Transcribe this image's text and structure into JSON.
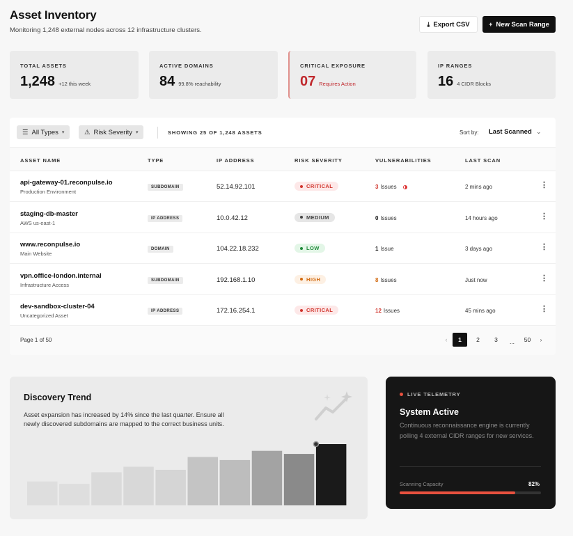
{
  "header": {
    "title": "Asset Inventory",
    "subtitle": "Monitoring 1,248 external nodes across 12 infrastructure clusters."
  },
  "actions": {
    "export_label": "Export CSV",
    "export_icon": "download-icon",
    "new_scan_label": "New Scan Range",
    "new_scan_icon": "plus-icon"
  },
  "stats": [
    {
      "label": "TOTAL ASSETS",
      "value": "1,248",
      "note": "+12 this week"
    },
    {
      "label": "ACTIVE DOMAINS",
      "value": "84",
      "note": "99.8% reachability"
    },
    {
      "label": "CRITICAL EXPOSURE",
      "value": "07",
      "note": "Requires Action"
    },
    {
      "label": "IP RANGES",
      "value": "16",
      "note": "4 CIDR Blocks"
    }
  ],
  "toolbar": {
    "filter_types": "All Types",
    "filter_risk": "Risk Severity",
    "showing": "SHOWING 25 OF 1,248 ASSETS",
    "sort_label": "Sort by:",
    "sort_value": "Last Scanned"
  },
  "columns": [
    "ASSET NAME",
    "TYPE",
    "IP ADDRESS",
    "RISK SEVERITY",
    "VULNERABILITIES",
    "LAST SCAN"
  ],
  "rows": [
    {
      "name": "api-gateway-01.reconpulse.io",
      "sub": "Production Environment",
      "type": "SUBDOMAIN",
      "ip": "52.14.92.101",
      "risk": "CRITICAL",
      "vuln_count": "3",
      "vuln_label": "Issues",
      "last_scan": "2 mins ago"
    },
    {
      "name": "staging-db-master",
      "sub": "AWS us-east-1",
      "type": "IP ADDRESS",
      "ip": "10.0.42.12",
      "risk": "MEDIUM",
      "vuln_count": "0",
      "vuln_label": "Issues",
      "last_scan": "14 hours ago"
    },
    {
      "name": "www.reconpulse.io",
      "sub": "Main Website",
      "type": "DOMAIN",
      "ip": "104.22.18.232",
      "risk": "LOW",
      "vuln_count": "1",
      "vuln_label": "Issue",
      "last_scan": "3 days ago"
    },
    {
      "name": "vpn.office-london.internal",
      "sub": "Infrastructure Access",
      "type": "SUBDOMAIN",
      "ip": "192.168.1.10",
      "risk": "HIGH",
      "vuln_count": "8",
      "vuln_label": "Issues",
      "last_scan": "Just now"
    },
    {
      "name": "dev-sandbox-cluster-04",
      "sub": "Uncategorized Asset",
      "type": "IP ADDRESS",
      "ip": "172.16.254.1",
      "risk": "CRITICAL",
      "vuln_count": "12",
      "vuln_label": "Issues",
      "last_scan": "45 mins ago"
    }
  ],
  "risk_colors": {
    "CRITICAL": {
      "bg": "#fde8e8",
      "fg": "#d0342c"
    },
    "MEDIUM": {
      "bg": "#e6e6e6",
      "fg": "#444444"
    },
    "LOW": {
      "bg": "#e3f6e7",
      "fg": "#1f8a3a"
    },
    "HIGH": {
      "bg": "#fdf0e3",
      "fg": "#d26b12"
    }
  },
  "pagination": {
    "info": "Page 1 of 50",
    "pages": [
      "1",
      "2",
      "3",
      "...",
      "50"
    ],
    "current": "1"
  },
  "trend": {
    "title": "Discovery Trend",
    "description": "Asset expansion has increased by 14% since the last quarter. Ensure all newly discovered subdomains are mapped to the correct business units.",
    "bar_levels": [
      0.39,
      0.35,
      0.54,
      0.63,
      0.58,
      0.79,
      0.74,
      0.89,
      0.84,
      1.0
    ]
  },
  "telemetry": {
    "live_label": "LIVE TELEMETRY",
    "title": "System Active",
    "description": "Continuous reconnaissance engine is currently polling 4 external CIDR ranges for new services.",
    "capacity_label": "Scanning Capacity",
    "capacity_value": "82%",
    "capacity_level": 0.82
  }
}
